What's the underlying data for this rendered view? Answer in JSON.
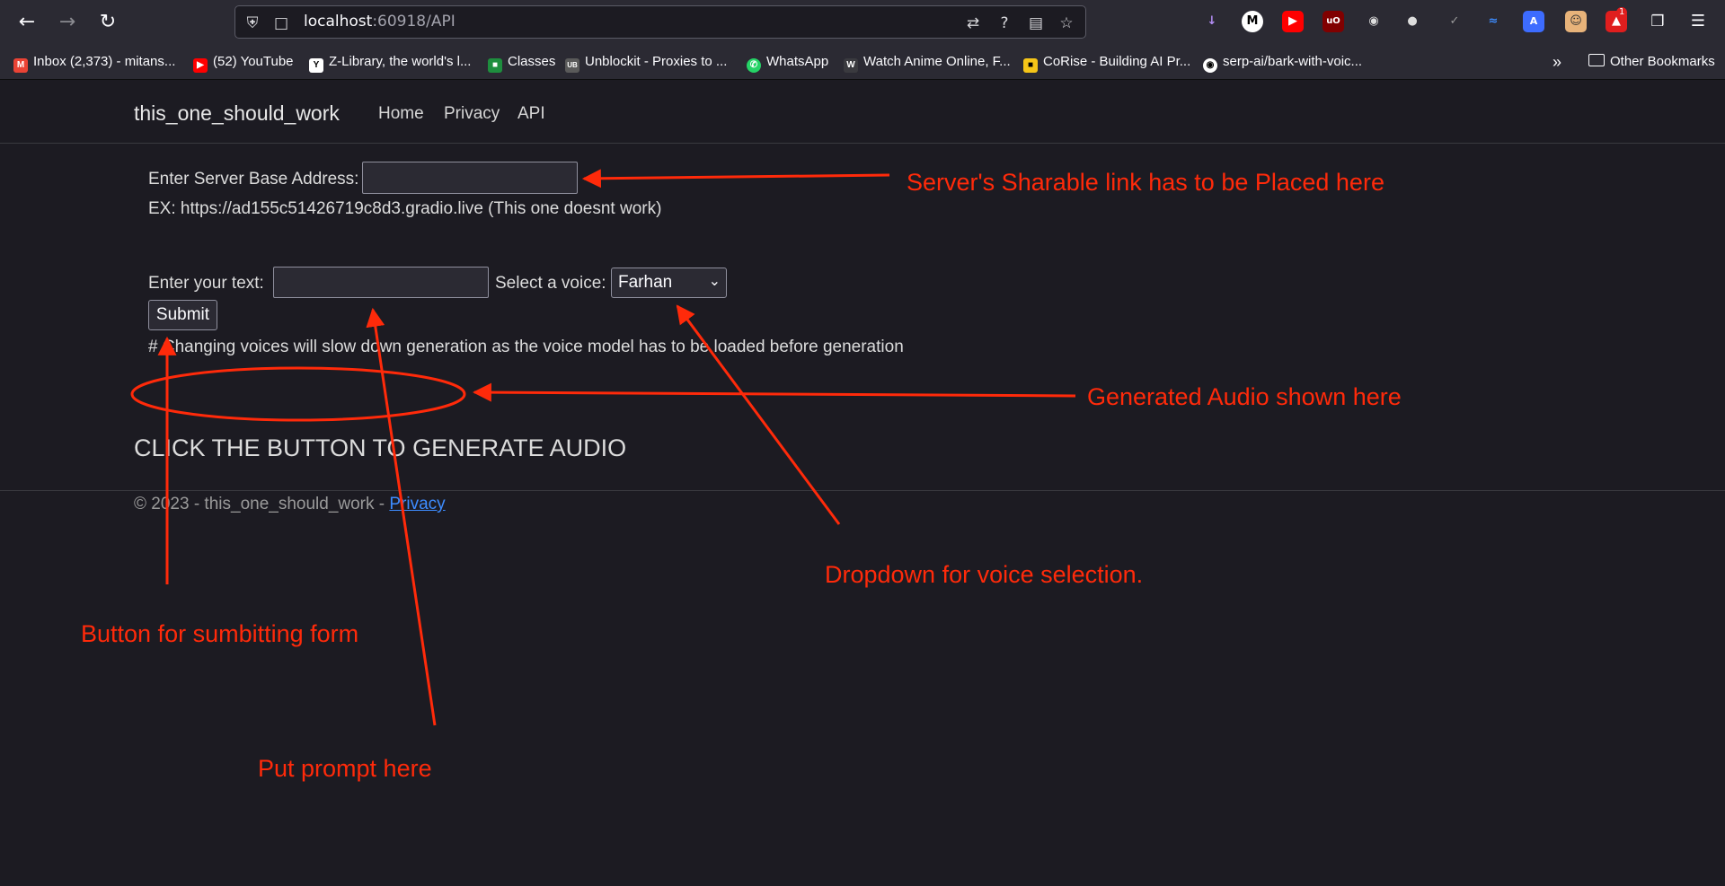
{
  "browser": {
    "url_host": "localhost",
    "url_rest": ":60918/API",
    "bookmarks": [
      {
        "label": "Inbox (2,373) - mitans...",
        "icon": "gmail-icon",
        "color": "#ea4335"
      },
      {
        "label": "(52) YouTube",
        "icon": "youtube-icon",
        "color": "#ff0000"
      },
      {
        "label": "Z-Library, the world's l...",
        "icon": "zlibrary-icon",
        "color": "#ffffff"
      },
      {
        "label": "Classes",
        "icon": "google-classroom-icon",
        "color": "#1e8e3e"
      },
      {
        "label": "Unblockit - Proxies to ...",
        "icon": "unblockit-icon",
        "color": "#9a9a9a"
      },
      {
        "label": "WhatsApp",
        "icon": "whatsapp-icon",
        "color": "#25d366"
      },
      {
        "label": "Watch Anime Online, F...",
        "icon": "anime-icon",
        "color": "#e8e8e8"
      },
      {
        "label": "CoRise - Building AI Pr...",
        "icon": "corise-icon",
        "color": "#f5c518"
      },
      {
        "label": "serp-ai/bark-with-voic...",
        "icon": "github-icon",
        "color": "#ffffff"
      }
    ],
    "other_bookmarks": "Other Bookmarks",
    "notification_badge": "1"
  },
  "site": {
    "brand": "this_one_should_work",
    "nav": [
      "Home",
      "Privacy",
      "API"
    ]
  },
  "form": {
    "server_label": "Enter Server Base Address:",
    "server_value": "",
    "example_text": "EX: https://ad155c51426719c8d3.gradio.live (This one doesnt work)",
    "text_label": "Enter your text:",
    "text_value": "",
    "voice_label": "Select a voice:",
    "voice_selected": "Farhan",
    "submit_label": "Submit",
    "note": "# Changing voices will slow down generation as the voice model has to be loaded before generation",
    "status_heading": "CLICK THE BUTTON TO GENERATE AUDIO"
  },
  "footer": {
    "text": "© 2023 - this_one_should_work - ",
    "link": "Privacy"
  },
  "annotations": {
    "server_link": "Server's Sharable link has to be Placed here",
    "audio": "Generated Audio shown here",
    "dropdown": "Dropdown for voice selection.",
    "button": "Button for sumbitting form",
    "prompt": "Put prompt here"
  },
  "colors": {
    "annotation": "#ff2a0a",
    "page_bg": "#1c1b22",
    "link": "#3d8cff"
  }
}
